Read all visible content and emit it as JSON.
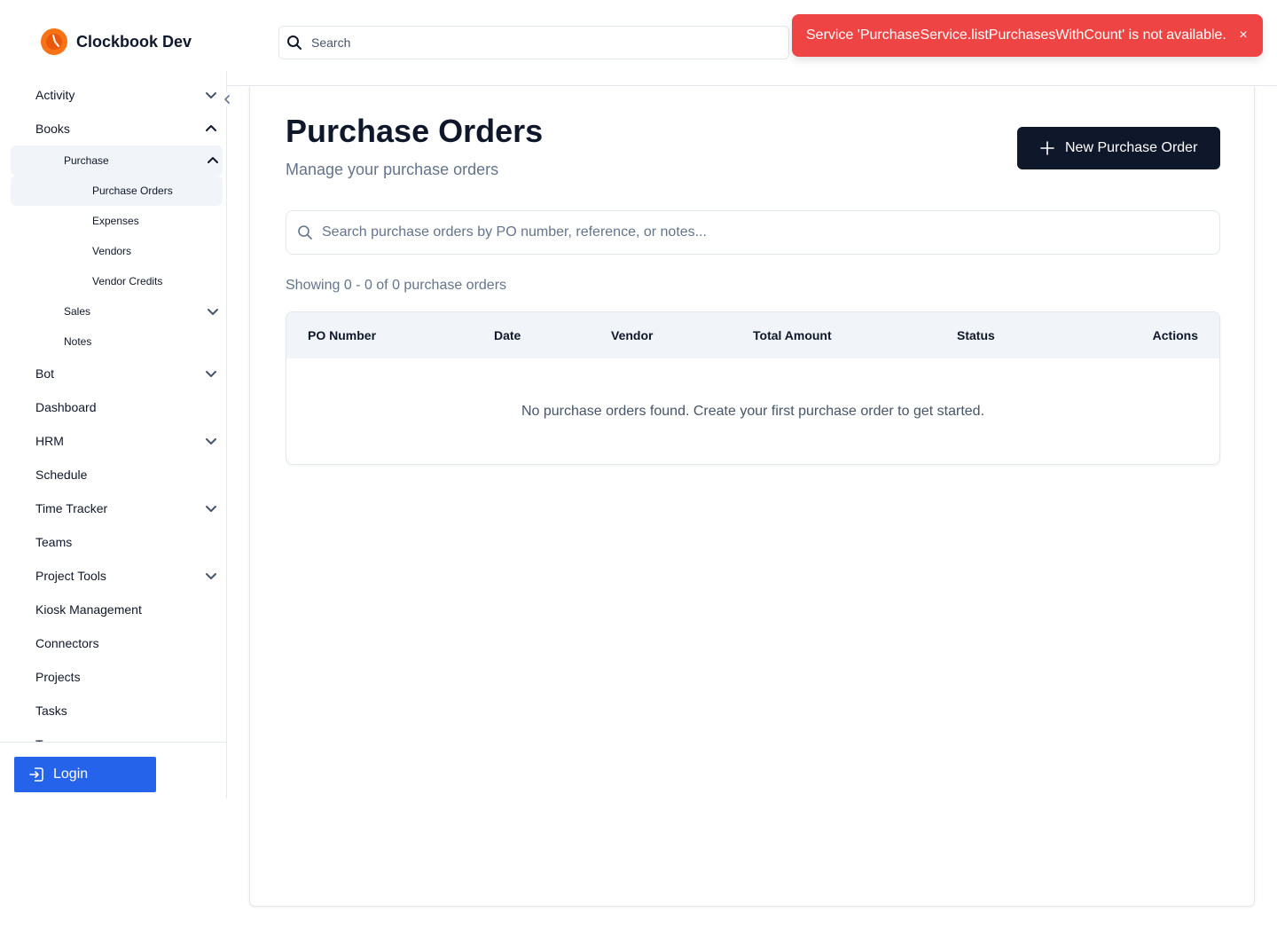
{
  "app": {
    "name": "Clockbook Dev"
  },
  "header": {
    "search_placeholder": "Search"
  },
  "toast": {
    "message": "Service 'PurchaseService.listPurchasesWithCount' is not available.",
    "close": "×",
    "color": "#ef4444"
  },
  "sidebar": {
    "items": [
      {
        "label": "Activity",
        "expandable": true
      },
      {
        "label": "Books",
        "expandable": true,
        "expanded": true
      },
      {
        "label": "Purchase",
        "expandable": true,
        "expanded": true
      },
      {
        "label": "Purchase Orders",
        "active": true
      },
      {
        "label": "Expenses"
      },
      {
        "label": "Vendors"
      },
      {
        "label": "Vendor Credits"
      },
      {
        "label": "Sales",
        "expandable": true
      },
      {
        "label": "Notes"
      },
      {
        "label": "Bot",
        "expandable": true
      },
      {
        "label": "Dashboard"
      },
      {
        "label": "HRM",
        "expandable": true
      },
      {
        "label": "Schedule"
      },
      {
        "label": "Time Tracker",
        "expandable": true
      },
      {
        "label": "Teams"
      },
      {
        "label": "Project Tools",
        "expandable": true
      },
      {
        "label": "Kiosk Management"
      },
      {
        "label": "Connectors"
      },
      {
        "label": "Projects"
      },
      {
        "label": "Tasks"
      },
      {
        "label": "T"
      }
    ],
    "login_label": "Login",
    "login_color": "#2563eb"
  },
  "main": {
    "title": "Purchase Orders",
    "subtitle": "Manage your purchase orders",
    "new_button": "New Purchase Order",
    "search_placeholder": "Search purchase orders by PO number, reference, or notes...",
    "showing": "Showing 0 - 0 of 0 purchase orders",
    "columns": [
      "PO Number",
      "Date",
      "Vendor",
      "Total Amount",
      "Status",
      "Actions"
    ],
    "empty_message": "No purchase orders found. Create your first purchase order to get started."
  }
}
